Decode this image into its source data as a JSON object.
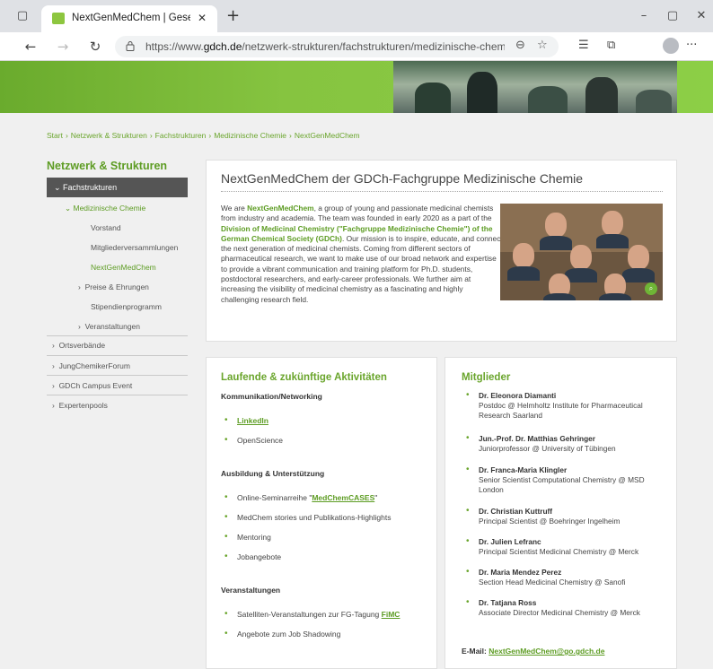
{
  "browser": {
    "tab_title": "NextGenMedChem | Gesellschaft",
    "new_tab": "+",
    "url_prefix": "https://www.",
    "url_host": "gdch.de",
    "url_path": "/netzwerk-strukturen/fachstrukturen/medizinische-chemie/next..."
  },
  "breadcrumb": [
    "Start",
    "Netzwerk & Strukturen",
    "Fachstrukturen",
    "Medizinische Chemie",
    "NextGenMedChem"
  ],
  "sidebar": {
    "title": "Netzwerk & Strukturen",
    "active": "Fachstrukturen",
    "sub_section": "Medizinische Chemie",
    "items": [
      "Vorstand",
      "Mitgliederversammlungen",
      "NextGenMedChem",
      "Preise & Ehrungen",
      "Stipendienprogramm",
      "Veranstaltungen"
    ],
    "top_items": [
      "Ortsverbände",
      "JungChemikerForum",
      "GDCh Campus Event",
      "Expertenpools"
    ]
  },
  "intro": {
    "title": "NextGenMedChem der GDCh-Fachgruppe Medizinische Chemie",
    "p1": "We are ",
    "b1": "NextGenMedChem",
    "p2": ", a group of young and passionate medicinal chemists from industry and academia. The team was founded in early 2020 as a part of the ",
    "b2": "Division of Medicinal Chemistry (\"Fachgruppe Medizinische Chemie\") of the German Chemical Society (GDCh)",
    "p3": ". Our mission is to inspire, educate, and connect the next generation of medicinal chemists. Coming from different sectors of pharmaceutical research, we want to make use of our broad network and expertise to provide a vibrant communication and training platform for Ph.D. students, postdoctoral researchers, and early-career professionals. We further aim at increasing the visibility of medicinal chemistry as a fascinating and highly challenging research field."
  },
  "activities": {
    "title": "Laufende & zukünftige Aktivitäten",
    "sec1": "Kommunikation/Networking",
    "linkedin": "LinkedIn",
    "openscience": "OpenScience",
    "sec2": "Ausbildung & Unterstützung",
    "seminar_pre": "Online-Seminarreihe \"",
    "seminar_link": "MedChemCASES",
    "seminar_post": "\"",
    "stories": "MedChem stories und Publikations-Highlights",
    "mentoring": "Mentoring",
    "jobs": "Jobangebote",
    "sec3": "Veranstaltungen",
    "satellite_pre": "Satelliten-Veranstaltungen zur FG-Tagung ",
    "satellite_link": "FiMC",
    "shadowing": "Angebote zum Job Shadowing"
  },
  "members": {
    "title": "Mitglieder",
    "list": [
      {
        "name": "Dr. Eleonora Diamanti",
        "role": "Postdoc @ Helmholtz Institute for Pharmaceutical Research Saarland"
      },
      {
        "name": "Jun.-Prof. Dr. Matthias Gehringer",
        "role": "Juniorprofessor @ University of Tübingen"
      },
      {
        "name": "Dr. Franca-Maria Klingler",
        "role": "Senior Scientist Computational Chemistry @ MSD London"
      },
      {
        "name": "Dr. Christian Kuttruff",
        "role": "Principal Scientist @ Boehringer Ingelheim"
      },
      {
        "name": "Dr. Julien Lefranc",
        "role": "Principal Scientist Medicinal Chemistry @ Merck"
      },
      {
        "name": "Dr. Maria Mendez Perez",
        "role": "Section Head Medicinal Chemistry @ Sanofi"
      },
      {
        "name": "Dr. Tatjana Ross",
        "role": "Associate Director Medicinal Chemistry @ Merck"
      }
    ],
    "email_label": "E-Mail: ",
    "email": "NextGenMedChem@go.gdch.de"
  },
  "colors": {
    "accent": "#6aa52c",
    "sidebar_active": "#555555"
  }
}
